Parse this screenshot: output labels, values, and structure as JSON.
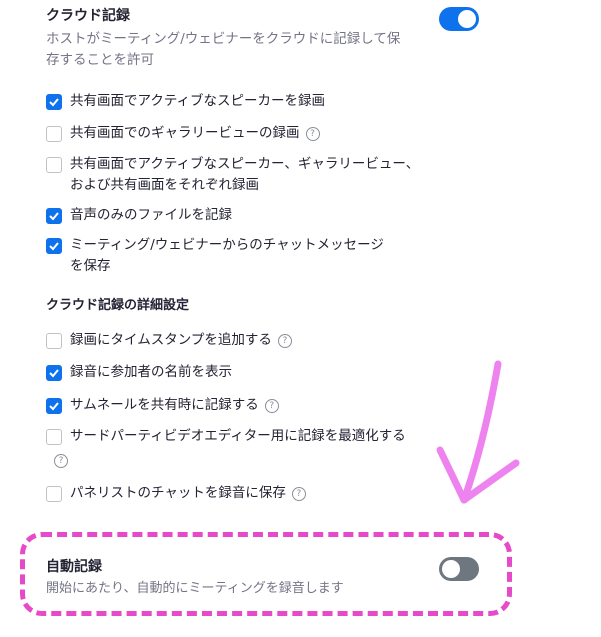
{
  "cloud_recording": {
    "title": "クラウド記録",
    "description_line1": "ホストがミーティング/ウェビナーをクラウドに記録して保",
    "description_line2": "存することを許可",
    "toggle_state": "on"
  },
  "options": [
    {
      "label": "共有画面でアクティブなスピーカーを録画",
      "checked": true
    },
    {
      "label": "共有画面でのギャラリービューの録画",
      "checked": false,
      "help": "?"
    },
    {
      "label": "共有画面でアクティブなスピーカー、ギャラリービュー、",
      "label2": "および共有画面をそれぞれ録画",
      "checked": false
    },
    {
      "label": "音声のみのファイルを記録",
      "checked": true
    },
    {
      "label": "ミーティング/ウェビナーからのチャットメッセージ",
      "label2": "を保存",
      "checked": true
    }
  ],
  "advanced": {
    "title": "クラウド記録の詳細設定",
    "options": [
      {
        "label": "録画にタイムスタンプを追加する",
        "checked": false,
        "help": "?"
      },
      {
        "label": "録音に参加者の名前を表示",
        "checked": true
      },
      {
        "label": "サムネールを共有時に記録する",
        "checked": true,
        "help": "?"
      },
      {
        "label": "サードパーティビデオエディター用に記録を最適化する",
        "checked": false,
        "help": "?"
      },
      {
        "label": "パネリストのチャットを録音に保存",
        "checked": false,
        "help": "?"
      }
    ]
  },
  "auto_recording": {
    "title": "自動記録",
    "description": "開始にあたり、自動的にミーティングを録音します",
    "toggle_state": "off"
  },
  "colors": {
    "accent": "#0e72ed",
    "annotation": "#e64ac8",
    "toggle_off": "#6e7680"
  }
}
